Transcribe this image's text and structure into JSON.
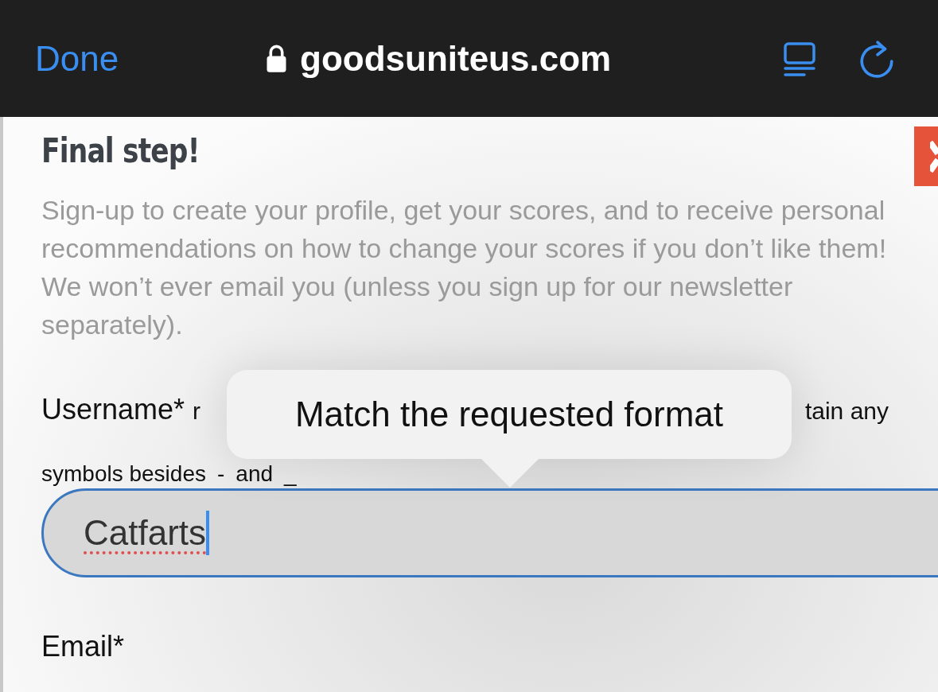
{
  "browser_bar": {
    "done": "Done",
    "url": "goodsuniteus.com"
  },
  "page": {
    "heading": "Final step!",
    "intro": "Sign-up to create your profile, get your scores, and to receive personal recommendations on how to change your scores if you don’t like them! We won’t ever email you (unless you sign up for our newsletter separately).",
    "username": {
      "label": "Username*",
      "hint_left": "r",
      "hint_right": "tain any",
      "hint_line2": [
        "symbols besides",
        "-",
        "and",
        "_"
      ],
      "value": "Catfarts",
      "misspelled": true,
      "focused": true
    },
    "tooltip": "Match the requested format",
    "email_label": "Email*"
  }
}
